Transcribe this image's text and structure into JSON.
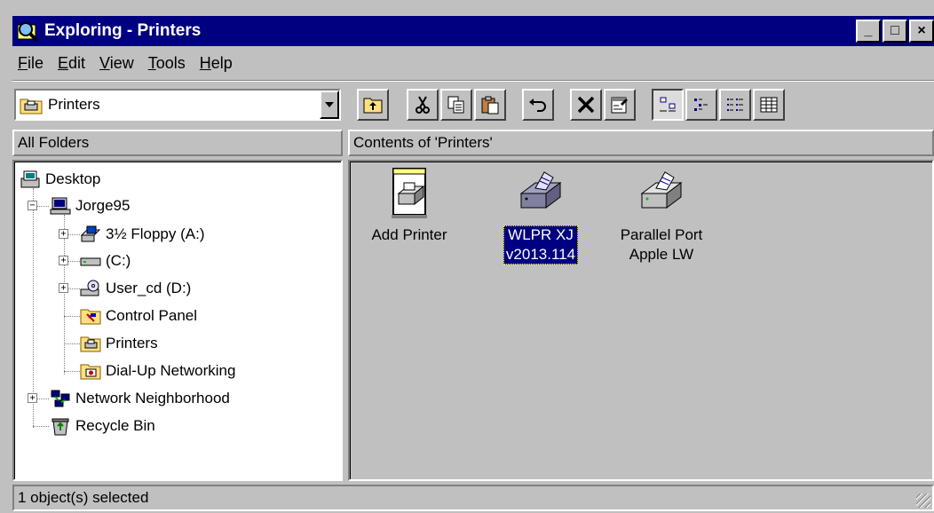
{
  "window": {
    "title": "Exploring - Printers",
    "controls": {
      "minimize": "_",
      "maximize": "□",
      "close": "×"
    },
    "title_color": "#000080"
  },
  "menu": [
    {
      "underline": "F",
      "rest": "ile"
    },
    {
      "underline": "E",
      "rest": "dit"
    },
    {
      "underline": "V",
      "rest": "iew"
    },
    {
      "underline": "T",
      "rest": "ools"
    },
    {
      "underline": "H",
      "rest": "elp"
    }
  ],
  "address": {
    "value": "Printers",
    "icon": "printers-folder-icon"
  },
  "toolbar": {
    "buttons": [
      {
        "name": "up-one-level",
        "icon": "folder-up-icon"
      },
      {
        "name": "cut",
        "icon": "scissors-icon"
      },
      {
        "name": "copy",
        "icon": "copy-icon"
      },
      {
        "name": "paste",
        "icon": "clipboard-icon"
      },
      {
        "name": "undo",
        "icon": "undo-arrow-icon"
      },
      {
        "name": "delete",
        "icon": "delete-x-icon"
      },
      {
        "name": "properties",
        "icon": "properties-icon"
      },
      {
        "name": "large-icons",
        "icon": "large-icons-view-icon",
        "pressed": true
      },
      {
        "name": "small-icons",
        "icon": "small-icons-view-icon"
      },
      {
        "name": "list",
        "icon": "list-view-icon"
      },
      {
        "name": "details",
        "icon": "details-view-icon"
      }
    ]
  },
  "panes": {
    "left_header": "All Folders",
    "right_header": "Contents of 'Printers'"
  },
  "tree": [
    {
      "label": "Desktop",
      "icon": "desktop-icon"
    },
    {
      "label": "Jorge95",
      "icon": "my-computer-icon",
      "expander": "−"
    },
    {
      "label": "3½ Floppy (A:)",
      "icon": "floppy-drive-icon",
      "expander": "+"
    },
    {
      "label": "(C:)",
      "icon": "hard-drive-icon",
      "expander": "+"
    },
    {
      "label": "User_cd (D:)",
      "icon": "cd-drive-icon",
      "expander": "+"
    },
    {
      "label": "Control Panel",
      "icon": "control-panel-icon"
    },
    {
      "label": "Printers",
      "icon": "printers-folder-icon"
    },
    {
      "label": "Dial-Up Networking",
      "icon": "dialup-networking-icon"
    },
    {
      "label": "Network Neighborhood",
      "icon": "network-neighborhood-icon",
      "expander": "+"
    },
    {
      "label": "Recycle Bin",
      "icon": "recycle-bin-icon"
    }
  ],
  "items": [
    {
      "lines": [
        "Add Printer"
      ],
      "icon": "add-printer-icon",
      "selected": false
    },
    {
      "lines": [
        "WLPR XJ",
        "v2013.114"
      ],
      "icon": "network-printer-icon",
      "selected": true
    },
    {
      "lines": [
        "Parallel Port",
        "Apple LW"
      ],
      "icon": "printer-icon",
      "selected": false
    }
  ],
  "status": {
    "text": "1 object(s) selected"
  }
}
